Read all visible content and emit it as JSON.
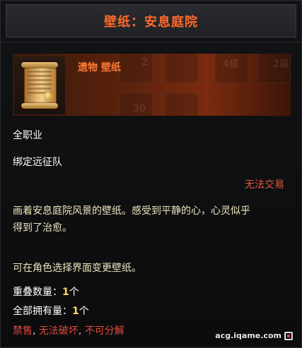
{
  "title": "壁纸：安息庭院",
  "header": {
    "rarity_label": "遗物 壁纸",
    "item_icon": "scroll-icon",
    "background_grid_text": [
      "2",
      "4级",
      "2级",
      "30"
    ]
  },
  "info": {
    "class": "全职业",
    "bind": "绑定远征队",
    "trade_status": "无法交易"
  },
  "description": {
    "line1": "画着安息庭院风景的壁纸。感受到平静的心，心灵似乎",
    "line2": "得到了治愈。",
    "line3": "可在角色选择界面变更壁纸。"
  },
  "stats": {
    "stack_label": "重叠数量：",
    "stack_value": "1",
    "stack_unit": "个",
    "owned_label": "全部拥有量：",
    "owned_value": "1",
    "owned_unit": "个"
  },
  "restrictions": {
    "sell": "禁售",
    "destroy": "无法破坏",
    "disassemble": "不可分解",
    "separator": ", "
  },
  "watermark": {
    "text": "acg.iqame.com",
    "icon": "watermark-logo-icon"
  },
  "colors": {
    "title": "#ff6a2a",
    "rarity": "#ff7a33",
    "warning": "#e45945",
    "number": "#ffd659",
    "description": "#ece4bf"
  }
}
